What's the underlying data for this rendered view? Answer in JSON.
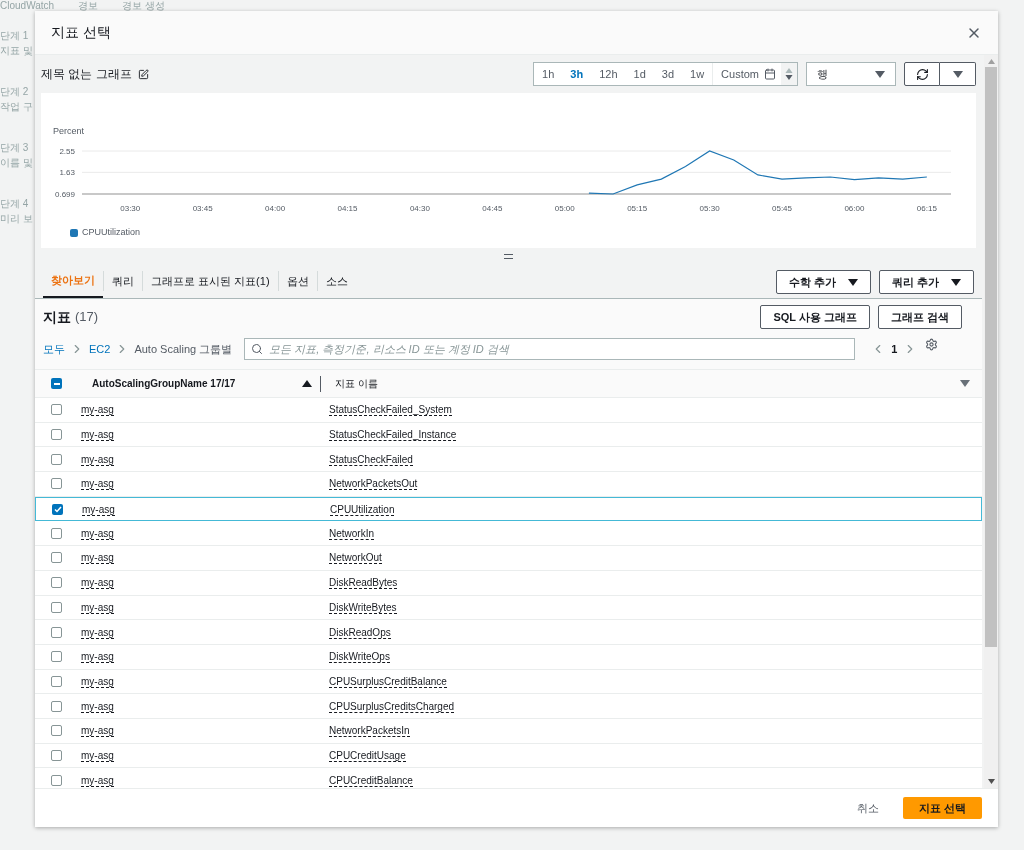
{
  "background": {
    "breadcrumb": [
      "CloudWatch",
      "경보",
      "경보 생성"
    ],
    "steps": [
      {
        "label": "단계 1",
        "title": "지표 및"
      },
      {
        "label": "단계 2",
        "title": "작업 구"
      },
      {
        "label": "단계 3",
        "title": "이름 및"
      },
      {
        "label": "단계 4",
        "title": "미리 보"
      }
    ]
  },
  "dialog": {
    "title": "지표 선택",
    "graph_title": "제목 없는 그래프",
    "time_ranges": [
      {
        "label": "1h",
        "selected": false
      },
      {
        "label": "3h",
        "selected": true
      },
      {
        "label": "12h",
        "selected": false
      },
      {
        "label": "1d",
        "selected": false
      },
      {
        "label": "3d",
        "selected": false
      },
      {
        "label": "1w",
        "selected": false
      }
    ],
    "custom": "Custom",
    "view_select": "행",
    "chart": {
      "chart_data": {
        "type": "line",
        "ylabel": "Percent",
        "x": [
          305,
          310,
          315,
          320,
          325,
          330,
          335,
          340,
          345,
          350,
          355,
          360,
          365,
          370,
          375
        ],
        "series": [
          {
            "name": "CPUUtilization",
            "color": "#1f77b4",
            "values": [
              0.74,
              0.7,
              1.09,
              1.34,
              1.88,
              2.55,
              2.16,
              1.52,
              1.34,
              1.39,
              1.43,
              1.32,
              1.39,
              1.34,
              1.43
            ]
          }
        ],
        "xlim": [
          200,
          380
        ],
        "ylim": [
          0.699,
          2.55
        ],
        "xticks": [
          {
            "value": 210,
            "label": "03:30"
          },
          {
            "value": 225,
            "label": "03:45"
          },
          {
            "value": 240,
            "label": "04:00"
          },
          {
            "value": 255,
            "label": "04:15"
          },
          {
            "value": 270,
            "label": "04:30"
          },
          {
            "value": 285,
            "label": "04:45"
          },
          {
            "value": 300,
            "label": "05:00"
          },
          {
            "value": 315,
            "label": "05:15"
          },
          {
            "value": 330,
            "label": "05:30"
          },
          {
            "value": 345,
            "label": "05:45"
          },
          {
            "value": 360,
            "label": "06:00"
          },
          {
            "value": 375,
            "label": "06:15"
          }
        ],
        "yticks": [
          {
            "value": 0.699,
            "label": "0.699"
          },
          {
            "value": 1.63,
            "label": "1.63"
          },
          {
            "value": 2.55,
            "label": "2.55"
          }
        ]
      }
    },
    "tabs": [
      {
        "label": "찾아보기",
        "selected": true
      },
      {
        "label": "쿼리",
        "selected": false
      },
      {
        "label": "그래프로 표시된 지표(1)",
        "selected": false
      },
      {
        "label": "옵션",
        "selected": false
      },
      {
        "label": "소스",
        "selected": false
      }
    ],
    "tab_buttons": [
      "수학 추가",
      "쿼리 추가"
    ],
    "metrics": {
      "title": "지표",
      "count": "(17)",
      "buttons": [
        "SQL 사용 그래프",
        "그래프 검색"
      ],
      "breadcrumb": [
        "모두",
        "EC2",
        "Auto Scaling 그룹별"
      ],
      "search_placeholder": "모든 지표, 측정기준, 리소스 ID 또는 계정 ID 검색",
      "page": "1",
      "select_all_indeterminate": true,
      "columns": [
        "AutoScalingGroupName 17/17",
        "지표 이름"
      ],
      "rows": [
        {
          "group": "my-asg",
          "metric": "StatusCheckFailed_System",
          "checked": false
        },
        {
          "group": "my-asg",
          "metric": "StatusCheckFailed_Instance",
          "checked": false
        },
        {
          "group": "my-asg",
          "metric": "StatusCheckFailed",
          "checked": false
        },
        {
          "group": "my-asg",
          "metric": "NetworkPacketsOut",
          "checked": false
        },
        {
          "group": "my-asg",
          "metric": "CPUUtilization",
          "checked": true
        },
        {
          "group": "my-asg",
          "metric": "NetworkIn",
          "checked": false
        },
        {
          "group": "my-asg",
          "metric": "NetworkOut",
          "checked": false
        },
        {
          "group": "my-asg",
          "metric": "DiskReadBytes",
          "checked": false
        },
        {
          "group": "my-asg",
          "metric": "DiskWriteBytes",
          "checked": false
        },
        {
          "group": "my-asg",
          "metric": "DiskReadOps",
          "checked": false
        },
        {
          "group": "my-asg",
          "metric": "DiskWriteOps",
          "checked": false
        },
        {
          "group": "my-asg",
          "metric": "CPUSurplusCreditBalance",
          "checked": false
        },
        {
          "group": "my-asg",
          "metric": "CPUSurplusCreditsCharged",
          "checked": false
        },
        {
          "group": "my-asg",
          "metric": "NetworkPacketsIn",
          "checked": false
        },
        {
          "group": "my-asg",
          "metric": "CPUCreditUsage",
          "checked": false
        },
        {
          "group": "my-asg",
          "metric": "CPUCreditBalance",
          "checked": false
        }
      ]
    },
    "footer": {
      "cancel": "취소",
      "confirm": "지표 선택"
    }
  }
}
